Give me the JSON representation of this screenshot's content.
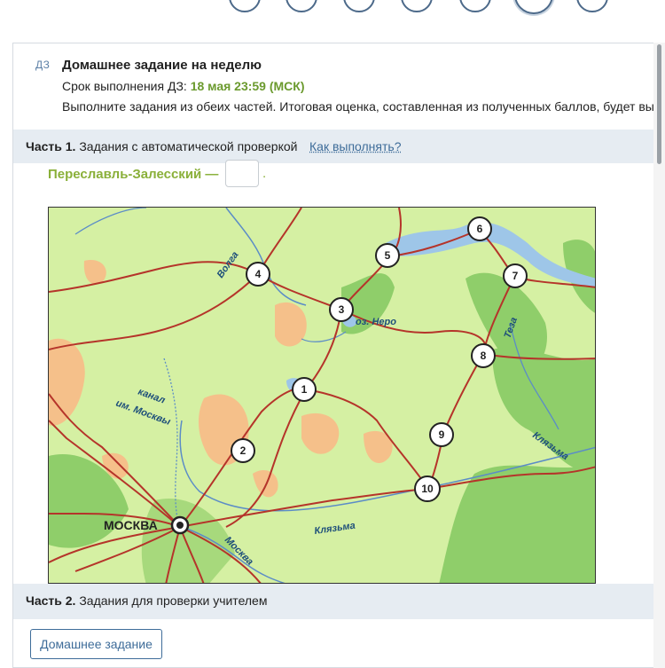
{
  "header": {
    "tag": "ДЗ",
    "title": "Домашнее задание на неделю",
    "deadline_label": "Срок выполнения ДЗ:",
    "deadline_value": "18 мая 23:59 (МСК)",
    "instruction": "Выполните задания из обеих частей. Итоговая оценка, составленная из полученных баллов, будет выставлена"
  },
  "part1": {
    "number": "Часть 1.",
    "title": "Задания с автоматической проверкой",
    "how_link": "Как выполнять?"
  },
  "question": {
    "city_prefix": "Переславль-Залесский —",
    "answer_value": "",
    "suffix": "."
  },
  "map": {
    "city_label": "МОСКВА",
    "markers": [
      "1",
      "2",
      "3",
      "4",
      "5",
      "6",
      "7",
      "8",
      "9",
      "10"
    ],
    "labels": {
      "volga": "Волга",
      "nero": "оз. Неро",
      "teza": "Теза",
      "kanal_1": "канал",
      "kanal_2": "им. Москвы",
      "klyazma_1": "Клязьма",
      "klyazma_2": "Клязьма",
      "moskva_river": "Москва"
    }
  },
  "part2": {
    "number": "Часть 2.",
    "title": "Задания для проверки учителем"
  },
  "footer": {
    "homework_button": "Домашнее задание"
  },
  "colors": {
    "accent_green": "#6b9a2e",
    "link_blue": "#3e6c99",
    "section_bg": "#e6ecf2",
    "map_land": "#d5f0a3",
    "map_forest": "#8fce6a",
    "map_sand": "#f5c08a",
    "map_road": "#b5342a",
    "map_water": "#9ec6e8"
  }
}
